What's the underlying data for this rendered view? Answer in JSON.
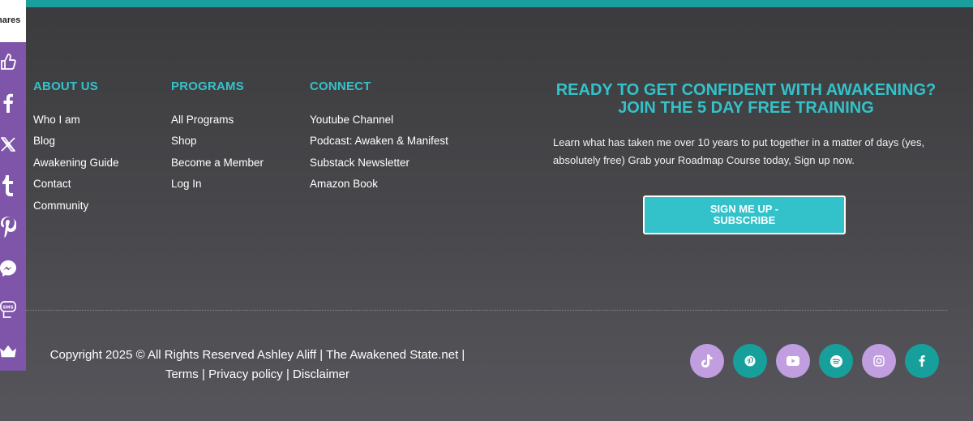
{
  "share_bar": {
    "count_label": "hares",
    "icons": [
      "thumbs-up-icon",
      "facebook-icon",
      "x-icon",
      "tumblr-icon",
      "pinterest-icon",
      "messenger-icon",
      "sms-icon",
      "crown-icon"
    ]
  },
  "columns": {
    "about": {
      "heading": "ABOUT US",
      "links": [
        "Who I am",
        "Blog",
        "Awakening Guide",
        "Contact",
        "Community"
      ]
    },
    "programs": {
      "heading": "PROGRAMS",
      "links": [
        "All Programs",
        "Shop",
        "Become a Member",
        "Log In"
      ]
    },
    "connect": {
      "heading": "CONNECT",
      "links": [
        "Youtube Channel",
        "Podcast: Awaken & Manifest",
        "Substack Newsletter",
        "Amazon Book"
      ]
    }
  },
  "cta": {
    "title_line1": "READY TO GET CONFIDENT WITH AWAKENING?",
    "title_line2": "JOIN THE 5 DAY FREE TRAINING",
    "description": "Learn what has taken me over 10 years to put together in a matter of days (yes, absolutely free) Grab your Roadmap Course today, Sign up now.",
    "button_label": "SIGN ME UP - SUBSCRIBE"
  },
  "footer": {
    "copyright": "Copyright 2025 © All Rights Reserved Ashley Aliff | The Awakened State.net |",
    "terms": "Terms",
    "sep1": "|",
    "privacy": "Privacy policy",
    "sep2": "|",
    "disclaimer": "Disclaimer"
  },
  "social": {
    "icons": [
      "tiktok-icon",
      "pinterest-icon",
      "youtube-icon",
      "spotify-icon",
      "instagram-icon",
      "facebook-icon"
    ],
    "colors": {
      "lavender": "#c09ee0",
      "teal": "#17a09b"
    }
  },
  "colors": {
    "accent": "#33c2c9",
    "top_bar": "#1a9e9e",
    "share_bar": "#7e55a8"
  }
}
